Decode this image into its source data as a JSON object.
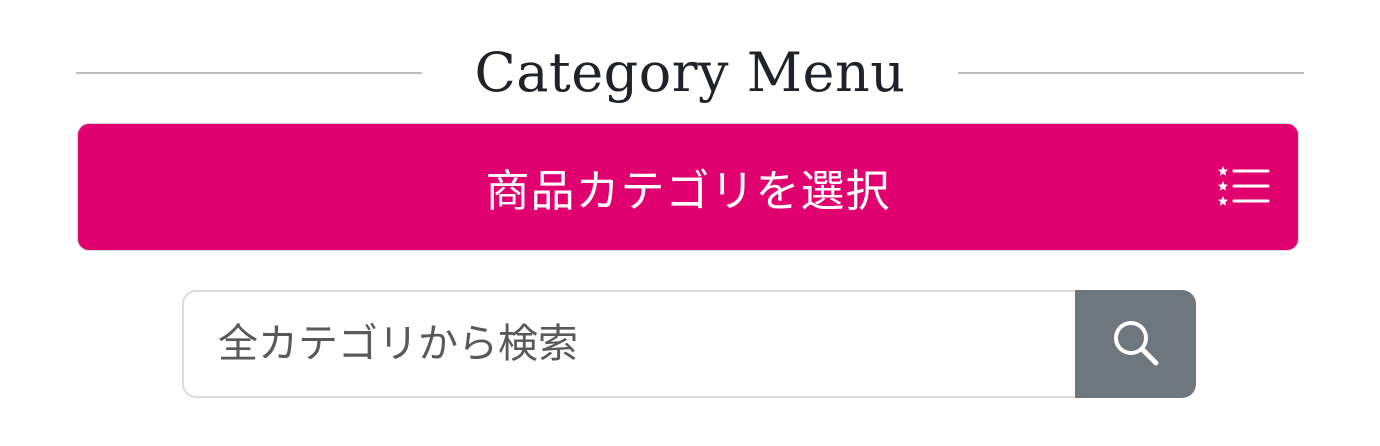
{
  "heading": {
    "title": "Category Menu"
  },
  "category_button": {
    "label": "商品カテゴリを選択",
    "icon": "star-list-icon",
    "background_color": "#e10070"
  },
  "search": {
    "placeholder": "全カテゴリから検索",
    "value": "",
    "button_icon": "search-icon",
    "button_color": "#6e767e"
  }
}
